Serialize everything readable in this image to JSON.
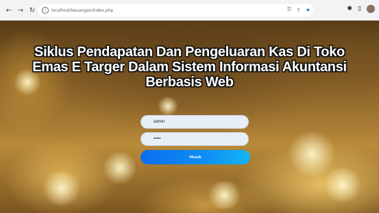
{
  "browser": {
    "url": "localhost/keuangan/index.php",
    "nav_icons": {
      "back": "back-arrow-icon",
      "forward": "forward-arrow-icon",
      "reload": "reload-icon",
      "info": "info-icon"
    },
    "omnibox_icons": [
      "key-icon",
      "share-icon",
      "star-icon"
    ],
    "extension_icons": [
      "puzzle-icon",
      "sidebar-icon",
      "profile-avatar"
    ],
    "accent_color": "#1a73e8"
  },
  "page": {
    "title": "Siklus Pendapatan Dan Pengeluaran Kas Di Toko Emas E Targer Dalam Sistem Informasi Akuntansi Berbasis Web",
    "login_form": {
      "username_value": "admin",
      "password_value": "•••••",
      "submit_label": "Masuk"
    },
    "colors": {
      "button_start": "#0b6ef0",
      "button_end": "#13b6f6",
      "input_background": "#e8eef8",
      "title_color": "#ffffff"
    }
  }
}
